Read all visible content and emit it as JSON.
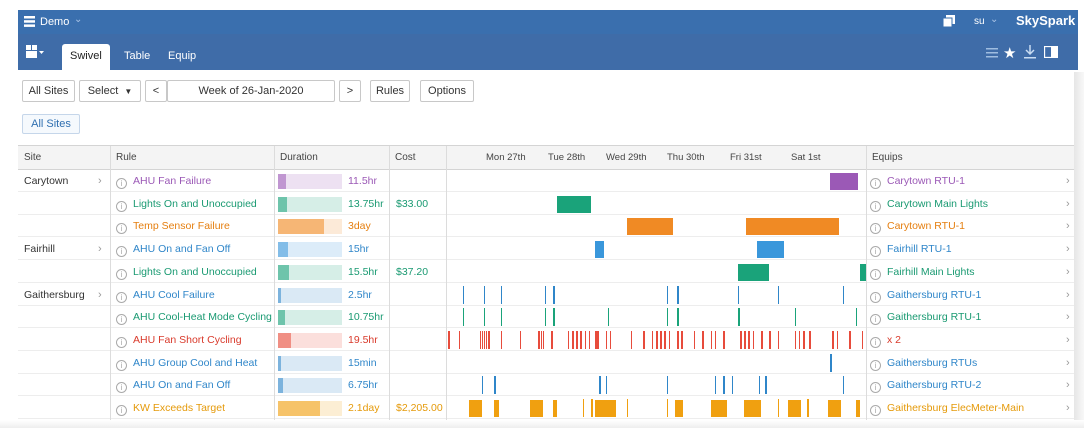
{
  "app": {
    "name": "Demo",
    "brand": "SkySpark",
    "user": "su"
  },
  "colors": {
    "topbar": "#3a6fae",
    "tabbar": "#3f6ca8"
  },
  "tabs": [
    {
      "label": "Swivel",
      "active": true
    },
    {
      "label": "Table"
    },
    {
      "label": "Equip"
    }
  ],
  "toolbar": {
    "all_sites": "All Sites",
    "select": "Select",
    "prev": "<",
    "range": "Week of 26-Jan-2020",
    "next": ">",
    "rules": "Rules",
    "options": "Options"
  },
  "filter_chip": "All Sites",
  "columns": {
    "site": "Site",
    "rule": "Rule",
    "duration": "Duration",
    "cost": "Cost",
    "equips": "Equips"
  },
  "timeline_days": [
    "Mon 27th",
    "Tue 28th",
    "Wed 29th",
    "Thu 30th",
    "Fri 31st",
    "Sat 1st"
  ],
  "rows": [
    {
      "site": "Carytown",
      "rule": "AHU Fan Failure",
      "duration": "11.5hr",
      "cost": "",
      "equip": "Carytown RTU-1",
      "color": "#9b59b6",
      "dur_fraction": 0.12,
      "text_color": "#9b59b6"
    },
    {
      "site": "",
      "rule": "Lights On and Unoccupied",
      "duration": "13.75hr",
      "cost": "$33.00",
      "equip": "Carytown Main Lights",
      "color": "#1aa37a",
      "dur_fraction": 0.14,
      "text_color": "#1a9a72"
    },
    {
      "site": "",
      "rule": "Temp Sensor Failure",
      "duration": "3day",
      "cost": "",
      "equip": "Carytown RTU-1",
      "color": "#f08a24",
      "dur_fraction": 0.72,
      "text_color": "#e57f10"
    },
    {
      "site": "Fairhill",
      "rule": "AHU On and Fan Off",
      "duration": "15hr",
      "cost": "",
      "equip": "Fairhill RTU-1",
      "color": "#3a97db",
      "dur_fraction": 0.16,
      "text_color": "#2f86c9"
    },
    {
      "site": "",
      "rule": "Lights On and Unoccupied",
      "duration": "15.5hr",
      "cost": "$37.20",
      "equip": "Fairhill Main Lights",
      "color": "#1aa37a",
      "dur_fraction": 0.17,
      "text_color": "#1a9a72"
    },
    {
      "site": "Gaithersburg",
      "rule": "AHU Cool Failure",
      "duration": "2.5hr",
      "cost": "",
      "equip": "Gaithersburg RTU-1",
      "color": "#2f86c9",
      "dur_fraction": 0.03,
      "text_color": "#2f86c9"
    },
    {
      "site": "",
      "rule": "AHU Cool-Heat Mode Cycling",
      "duration": "10.75hr",
      "cost": "",
      "equip": "Gaithersburg RTU-1",
      "color": "#1aa37a",
      "dur_fraction": 0.11,
      "text_color": "#1a9a72"
    },
    {
      "site": "",
      "rule": "AHU Fan Short Cycling",
      "duration": "19.5hr",
      "cost": "",
      "equip": "x 2",
      "color": "#e74c3c",
      "dur_fraction": 0.21,
      "text_color": "#d93a2b"
    },
    {
      "site": "",
      "rule": "AHU Group Cool and Heat",
      "duration": "15min",
      "cost": "",
      "equip": "Gaithersburg RTUs",
      "color": "#2f86c9",
      "dur_fraction": 0.02,
      "text_color": "#2f86c9"
    },
    {
      "site": "",
      "rule": "AHU On and Fan Off",
      "duration": "6.75hr",
      "cost": "",
      "equip": "Gaithersburg RTU-2",
      "color": "#2f86c9",
      "dur_fraction": 0.08,
      "text_color": "#2f86c9"
    },
    {
      "site": "",
      "rule": "KW Exceeds Target",
      "duration": "2.1day",
      "cost": "$2,205.00",
      "equip": "Gaithersburg ElecMeter-Main",
      "color": "#f0a010",
      "dur_fraction": 0.65,
      "text_color": "#e59a0a"
    }
  ]
}
